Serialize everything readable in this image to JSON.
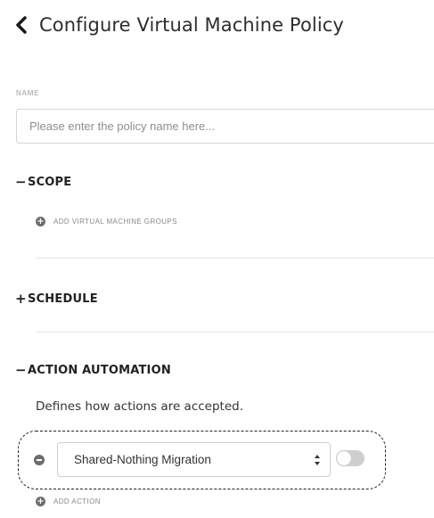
{
  "header": {
    "title": "Configure Virtual Machine Policy",
    "back_icon": "chevron-left-icon"
  },
  "name_field": {
    "label": "NAME",
    "value": "",
    "placeholder": "Please enter the policy name here..."
  },
  "sections": {
    "scope": {
      "sign": "−",
      "title": "SCOPE",
      "add_label": "ADD VIRTUAL MACHINE GROUPS"
    },
    "schedule": {
      "sign": "+",
      "title": "SCHEDULE"
    },
    "action_automation": {
      "sign": "−",
      "title": "ACTION AUTOMATION",
      "description": "Defines how actions are accepted.",
      "action": {
        "selected": "Shared-Nothing Migration",
        "enabled": false
      },
      "add_label": "ADD ACTION"
    }
  },
  "colors": {
    "toggle_off": "#cfcfcf",
    "icon_gray": "#6d6d6d",
    "highlight_border": "#222222"
  }
}
